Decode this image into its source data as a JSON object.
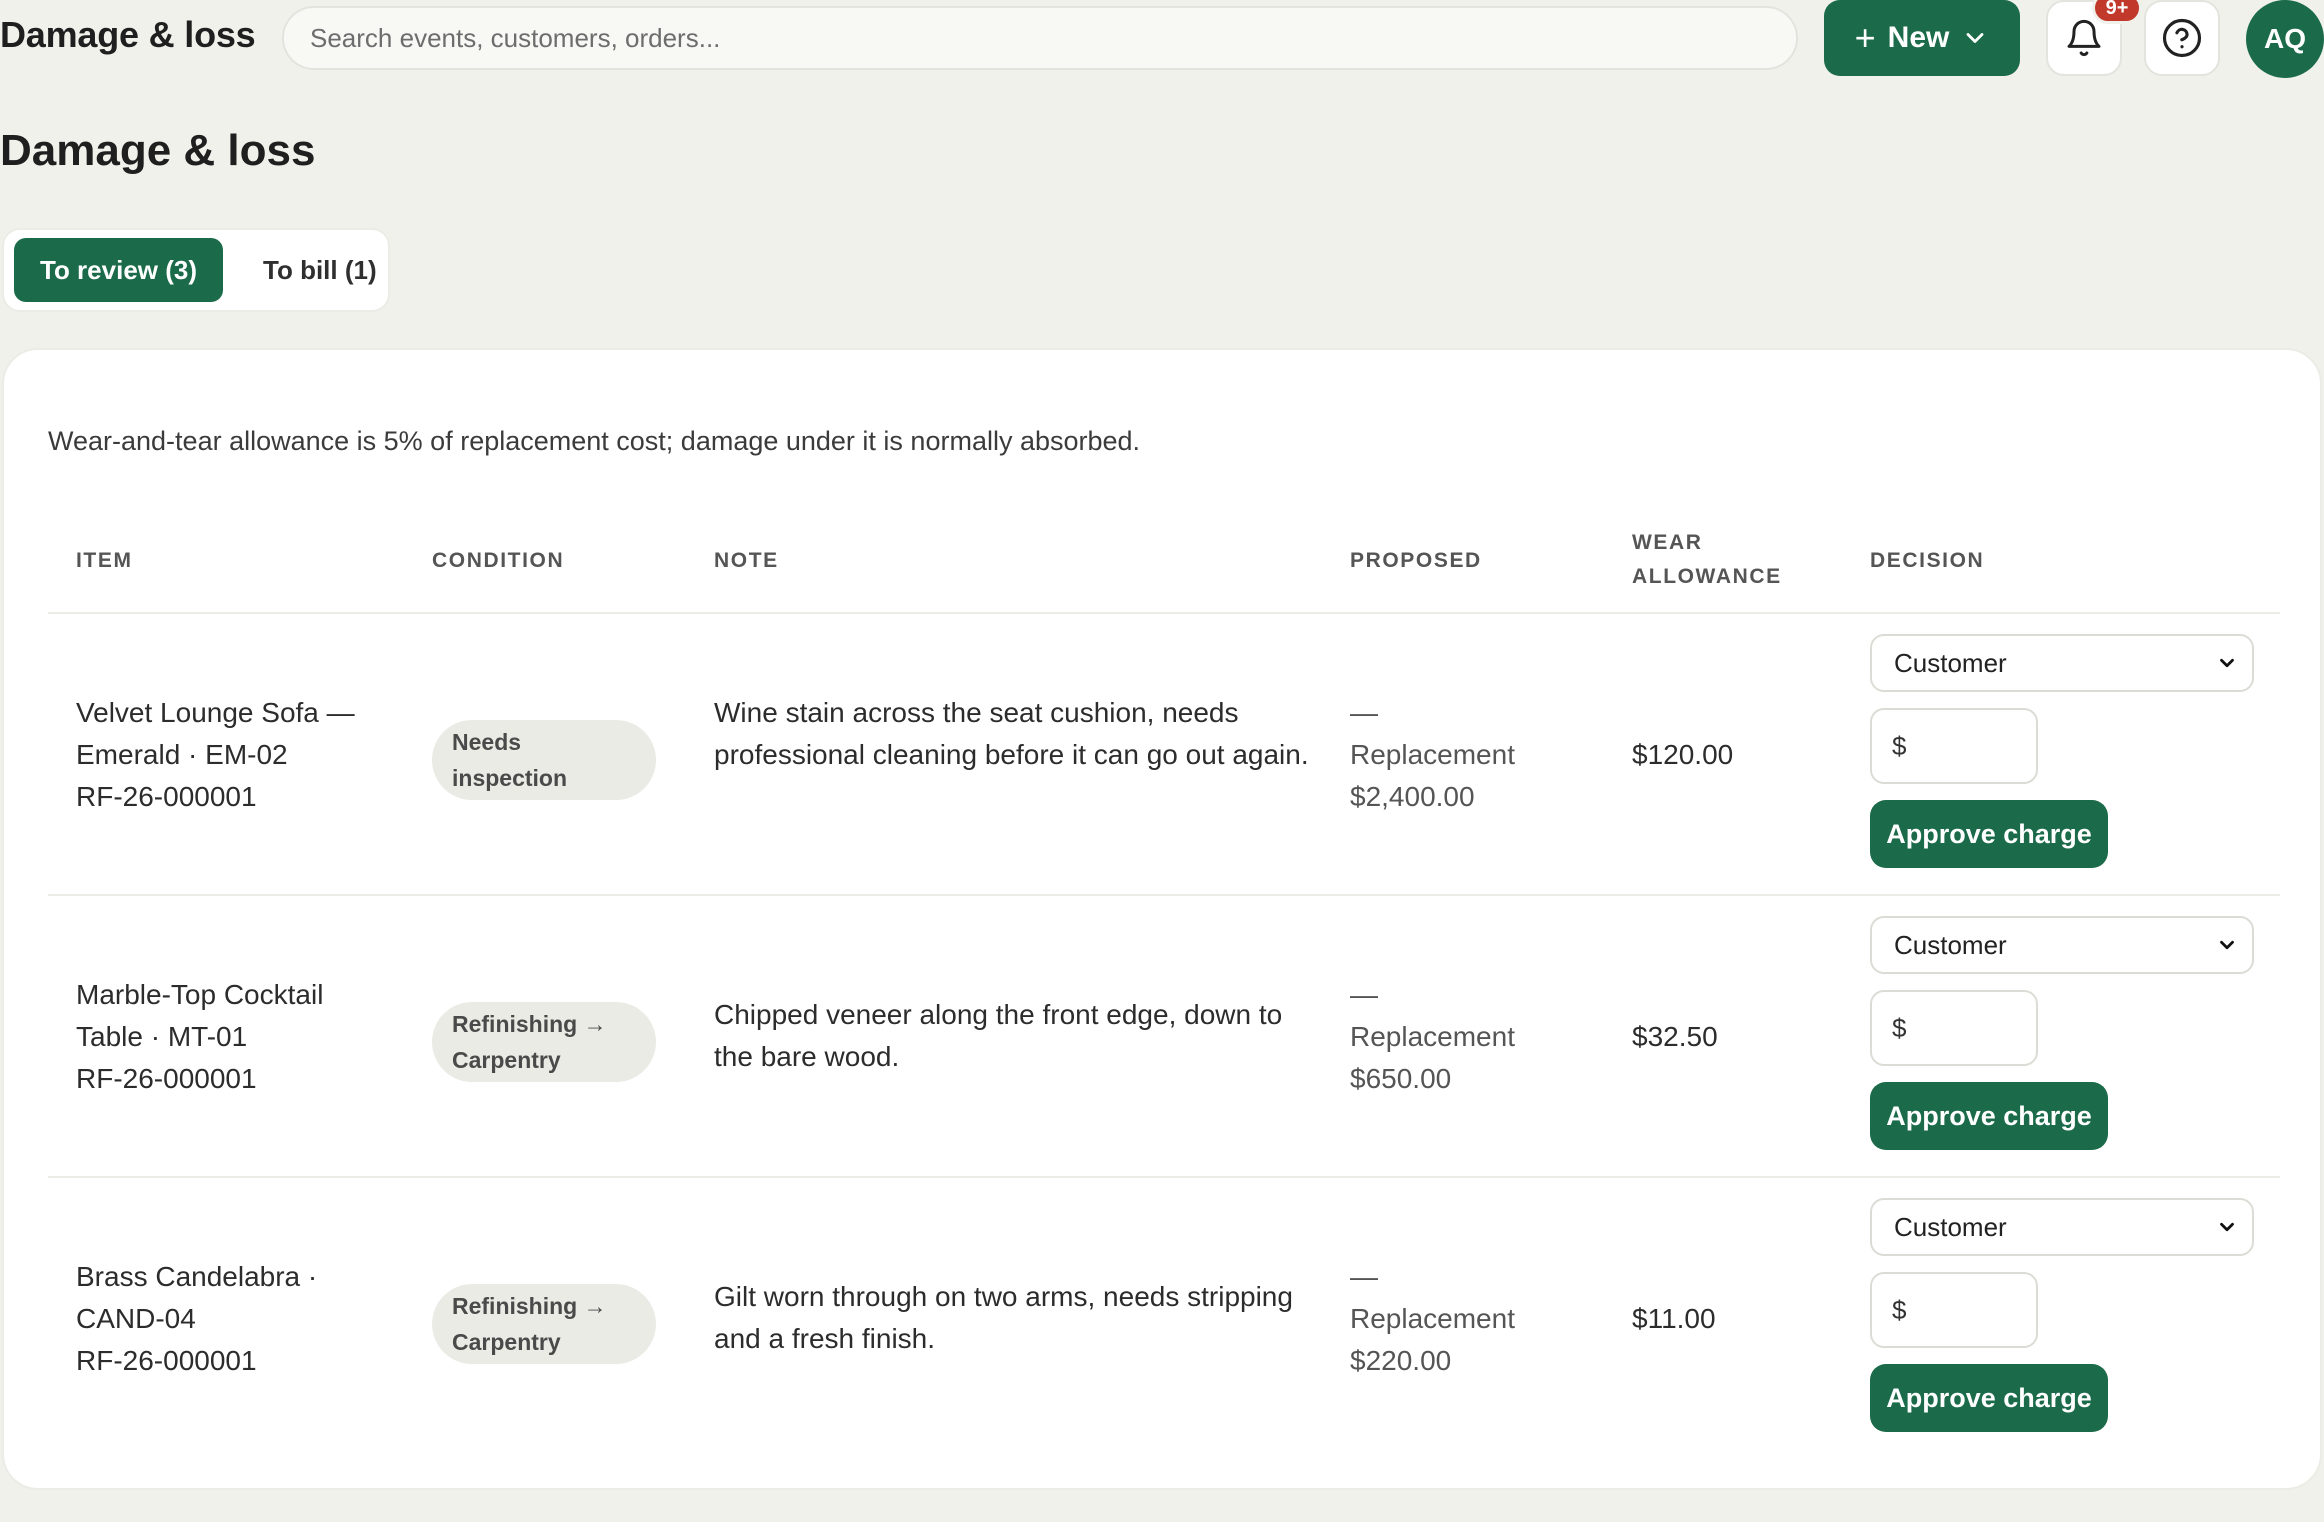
{
  "header": {
    "app_title": "Damage & loss",
    "search_placeholder": "Search events, customers, orders...",
    "new_button": "New",
    "notification_badge": "9+",
    "avatar_initials": "AQ"
  },
  "page": {
    "title": "Damage & loss",
    "tabs": [
      {
        "label": "To review (3)",
        "active": true
      },
      {
        "label": "To bill (1)",
        "active": false
      }
    ],
    "allowance_note": "Wear-and-tear allowance is 5% of replacement cost; damage under it is normally absorbed."
  },
  "table": {
    "columns": {
      "item": "ITEM",
      "condition": "CONDITION",
      "note": "NOTE",
      "proposed": "PROPOSED",
      "wear_allowance_1": "WEAR",
      "wear_allowance_2": "ALLOWANCE",
      "decision": "DECISION"
    },
    "rows": [
      {
        "item_line1": "Velvet Lounge Sofa —",
        "item_line2": "Emerald · EM-02",
        "item_line3": "RF-26-000001",
        "condition": "Needs inspection",
        "note": "Wine stain across the seat cushion, needs professional cleaning before it can go out again.",
        "proposed_dash": "—",
        "proposed_label": "Replacement",
        "proposed_value": "$2,400.00",
        "wear_allowance": "$120.00",
        "decision_select": "Customer",
        "amount_prefix": "$",
        "approve_label": "Approve charge"
      },
      {
        "item_line1": "Marble-Top Cocktail",
        "item_line2": "Table · MT-01",
        "item_line3": "RF-26-000001",
        "condition": "Refinishing → Carpentry",
        "note": "Chipped veneer along the front edge, down to the bare wood.",
        "proposed_dash": "—",
        "proposed_label": "Replacement",
        "proposed_value": "$650.00",
        "wear_allowance": "$32.50",
        "decision_select": "Customer",
        "amount_prefix": "$",
        "approve_label": "Approve charge"
      },
      {
        "item_line1": "Brass Candelabra ·",
        "item_line2": "CAND-04",
        "item_line3": "RF-26-000001",
        "condition": "Refinishing → Carpentry",
        "note": "Gilt worn through on two arms, needs stripping and a fresh finish.",
        "proposed_dash": "—",
        "proposed_label": "Replacement",
        "proposed_value": "$220.00",
        "wear_allowance": "$11.00",
        "decision_select": "Customer",
        "amount_prefix": "$",
        "approve_label": "Approve charge"
      }
    ]
  },
  "colors": {
    "accent": "#1b6b4a",
    "badge": "#c0392b",
    "background": "#f1f1ec"
  },
  "icons": [
    "plus-icon",
    "chevron-down-icon",
    "bell-icon",
    "help-circle-icon"
  ]
}
